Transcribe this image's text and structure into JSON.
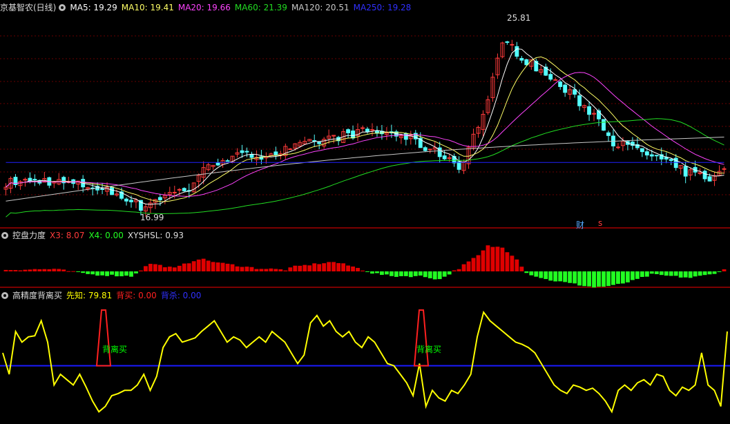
{
  "colors": {
    "background": "#000000",
    "grid": "#6a0000",
    "border": "#a40000",
    "up": "#ff3b3b",
    "down": "#54ffff",
    "ma5": "#ffffff",
    "ma10": "#ffff66",
    "ma20": "#ff44ff",
    "ma60": "#22dd22",
    "ma120": "#c8c8c8",
    "ma250": "#2020ff",
    "bar_up": "#e00000",
    "bar_down": "#22ff22",
    "xianzhi": "#ffff00",
    "beimai": "#ff2020",
    "beimai_label": "#00ff00",
    "baseline": "#1a1aff"
  },
  "icons": [
    "gear-icon"
  ],
  "panel1": {
    "title": "京基智农(日线)",
    "ma5": "MA5: 19.29",
    "ma10": "MA10: 19.41",
    "ma20": "MA20: 19.66",
    "ma60": "MA60: 21.39",
    "ma120": "MA120: 20.51",
    "ma250": "MA250: 19.28",
    "high_label": "25.81",
    "low_label": "16.99",
    "tag_cai": "财",
    "tag_s": "s"
  },
  "panel2": {
    "title": "控盘力度",
    "x3": "X3: 8.07",
    "x4": "X4: 0.00",
    "xyshsl": "XYSHSL: 0.93"
  },
  "panel3": {
    "title": "高精度背离买",
    "xianzhi": "先知: 79.81",
    "beimai": "背买: 0.00",
    "beimai2": "背杀: 0.00",
    "signal_label_1": "背离买",
    "signal_label_2": "背离买"
  },
  "chart_data": [
    {
      "type": "candlestick",
      "title": "京基智农(日线)",
      "ylim": [
        16.5,
        26.5
      ],
      "n_bars": 150,
      "close_keypoints": [
        [
          0,
          18.3
        ],
        [
          8,
          18.4
        ],
        [
          18,
          18.1
        ],
        [
          25,
          17.6
        ],
        [
          28,
          17.1
        ],
        [
          33,
          17.7
        ],
        [
          38,
          18.0
        ],
        [
          40,
          18.7
        ],
        [
          45,
          19.5
        ],
        [
          55,
          19.7
        ],
        [
          60,
          20.0
        ],
        [
          68,
          20.5
        ],
        [
          75,
          20.8
        ],
        [
          82,
          20.6
        ],
        [
          88,
          19.9
        ],
        [
          92,
          19.5
        ],
        [
          94,
          19.0
        ],
        [
          96,
          20.0
        ],
        [
          100,
          22.2
        ],
        [
          103,
          25.3
        ],
        [
          106,
          24.6
        ],
        [
          115,
          23.0
        ],
        [
          121,
          21.8
        ],
        [
          123,
          21.4
        ],
        [
          126,
          20.3
        ],
        [
          135,
          19.5
        ],
        [
          141,
          18.8
        ],
        [
          145,
          18.6
        ],
        [
          147,
          18.5
        ],
        [
          149,
          19.0
        ]
      ],
      "volatility": 0.45,
      "ma5_last": 19.29,
      "ma10_last": 19.41,
      "ma20_last": 19.66,
      "ma60_last": 21.39,
      "ma120_last": 20.51,
      "ma250_last": 19.28,
      "high": 25.81,
      "low": 16.99
    },
    {
      "type": "bar",
      "title": "控盘力度",
      "series_keypoints": [
        [
          0,
          1
        ],
        [
          10,
          1.5
        ],
        [
          18,
          -2
        ],
        [
          26,
          -3
        ],
        [
          30,
          5
        ],
        [
          35,
          2
        ],
        [
          40,
          8
        ],
        [
          45,
          5
        ],
        [
          52,
          2
        ],
        [
          58,
          1
        ],
        [
          60,
          3
        ],
        [
          65,
          5
        ],
        [
          68,
          6
        ],
        [
          72,
          3
        ],
        [
          76,
          -1
        ],
        [
          80,
          -3
        ],
        [
          86,
          -3
        ],
        [
          90,
          -5
        ],
        [
          94,
          2
        ],
        [
          98,
          10
        ],
        [
          100,
          16
        ],
        [
          103,
          15
        ],
        [
          106,
          8
        ],
        [
          108,
          -1
        ],
        [
          112,
          -5
        ],
        [
          118,
          -8
        ],
        [
          122,
          -10
        ],
        [
          126,
          -9
        ],
        [
          130,
          -6
        ],
        [
          134,
          -2
        ],
        [
          138,
          -3
        ],
        [
          142,
          -4
        ],
        [
          146,
          -2
        ],
        [
          149,
          1
        ]
      ],
      "x3_last": 8.07,
      "x4_last": 0.0
    },
    {
      "type": "line",
      "title": "高精度背离买",
      "ylim": [
        0,
        100
      ],
      "baseline": 48,
      "xianzhi": [
        60,
        40,
        80,
        70,
        75,
        76,
        90,
        70,
        30,
        40,
        35,
        30,
        40,
        28,
        15,
        5,
        10,
        20,
        22,
        25,
        25,
        30,
        40,
        25,
        38,
        65,
        75,
        78,
        70,
        72,
        74,
        80,
        85,
        90,
        80,
        70,
        75,
        72,
        65,
        70,
        75,
        70,
        80,
        75,
        70,
        60,
        50,
        58,
        88,
        95,
        85,
        90,
        80,
        75,
        80,
        70,
        65,
        75,
        70,
        60,
        50,
        48,
        40,
        32,
        20,
        50,
        10,
        25,
        18,
        15,
        25,
        22,
        30,
        40,
        75,
        98,
        90,
        85,
        80,
        75,
        70,
        68,
        65,
        60,
        50,
        40,
        30,
        25,
        22,
        30,
        28,
        25,
        27,
        22,
        15,
        5,
        25,
        30,
        25,
        32,
        35,
        30,
        40,
        38,
        25,
        20,
        28,
        25,
        30,
        60,
        30,
        25,
        10,
        80
      ],
      "beimai_spikes": [
        [
          40,
          100
        ],
        [
          170,
          100
        ]
      ]
    }
  ]
}
